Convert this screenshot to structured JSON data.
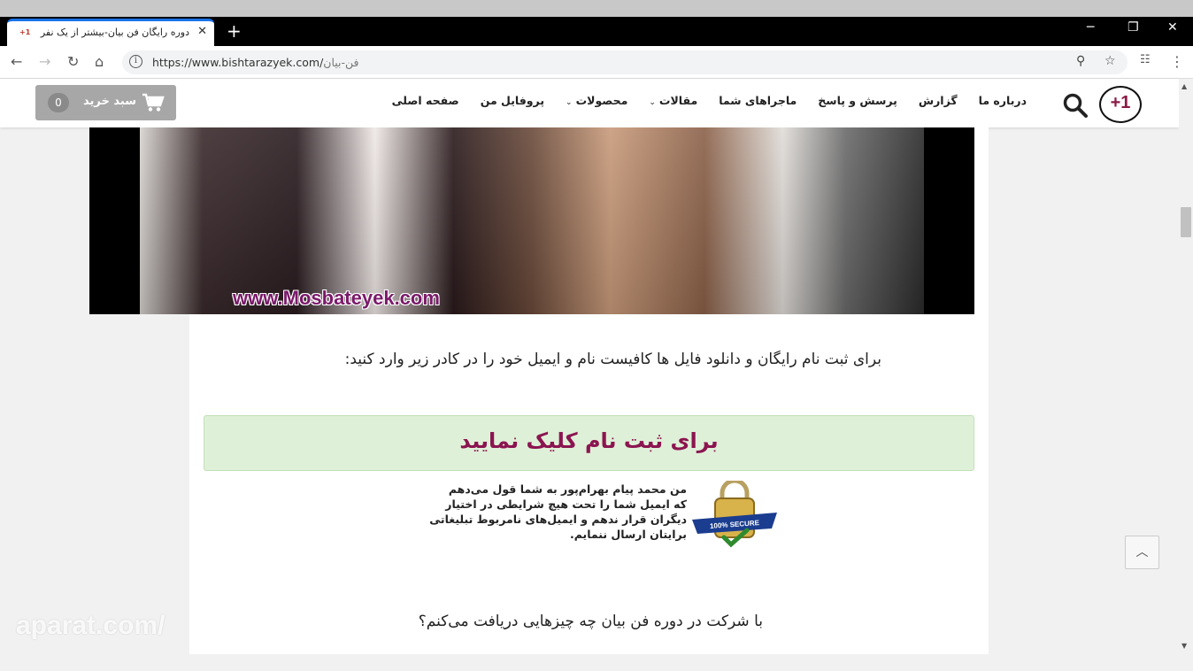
{
  "browser": {
    "tab_title": "دوره رایگان فن بیان-بیشتر از یک نفر",
    "favicon_text": "+1",
    "tab_close": "✕",
    "new_tab": "+",
    "url_host": "https://www.bishtarazyek.com/",
    "url_path": "فن-بیان",
    "win_min": "─",
    "win_restore": "❐",
    "win_close": "✕"
  },
  "header": {
    "logo_text": "+1",
    "menu": [
      {
        "label": "صفحه اصلی",
        "dropdown": false
      },
      {
        "label": "پروفایل من",
        "dropdown": false
      },
      {
        "label": "محصولات",
        "dropdown": true
      },
      {
        "label": "مقالات",
        "dropdown": true
      },
      {
        "label": "ماجراهای شما",
        "dropdown": false
      },
      {
        "label": "پرسش و پاسخ",
        "dropdown": false
      },
      {
        "label": "گزارش",
        "dropdown": false
      },
      {
        "label": "درباره ما",
        "dropdown": false
      }
    ],
    "cart_label": "سبد خرید",
    "cart_count": "0"
  },
  "video": {
    "watermark": "www.Mosbateyek.com"
  },
  "main": {
    "intro": "برای ثبت نام رایگان و دانلود فایل ها کافیست نام و ایمیل خود را در کادر زیر وارد کنید:",
    "cta": "برای ثبت نام کلیک نمایید",
    "pledge": [
      "من محمد پیام بهرام‌پور به شما قول می‌دهم",
      "که ایمیل شما را تحت هیچ شرایطی در اختیار",
      "دیگران قرار ندهم و ایمیل‌های نامربوط تبلیغاتی",
      "برایتان ارسال ننمایم."
    ],
    "badge_text": "100% SECURE",
    "question": "با شرکت در دوره فن بیان چه چیزهایی دریافت می‌کنم؟"
  },
  "overlay": {
    "aparat": "aparat.com/",
    "scroll_top": "︿"
  },
  "colors": {
    "cta_bg": "#dff0d8",
    "cta_text": "#8b1550",
    "logo_accent": "#8b1a47",
    "cart_bg": "#a7a7a7"
  }
}
